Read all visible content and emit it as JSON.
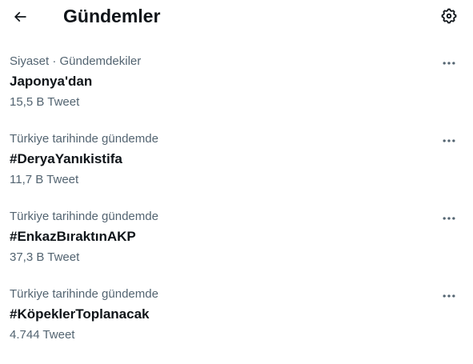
{
  "header": {
    "title": "Gündemler",
    "back_icon": "arrow-left-icon",
    "settings_icon": "gear-icon"
  },
  "trends": [
    {
      "context": "Siyaset · Gündemdekiler",
      "name": "Japonya'dan",
      "count": "15,5 B Tweet"
    },
    {
      "context": "Türkiye tarihinde gündemde",
      "name": "#DeryaYanıkistifa",
      "count": "11,7 B Tweet"
    },
    {
      "context": "Türkiye tarihinde gündemde",
      "name": "#EnkazBıraktınAKP",
      "count": "37,3 B Tweet"
    },
    {
      "context": "Türkiye tarihinde gündemde",
      "name": "#KöpeklerToplanacak",
      "count": "4.744 Tweet"
    }
  ],
  "more_icon": "more-horizontal-icon"
}
